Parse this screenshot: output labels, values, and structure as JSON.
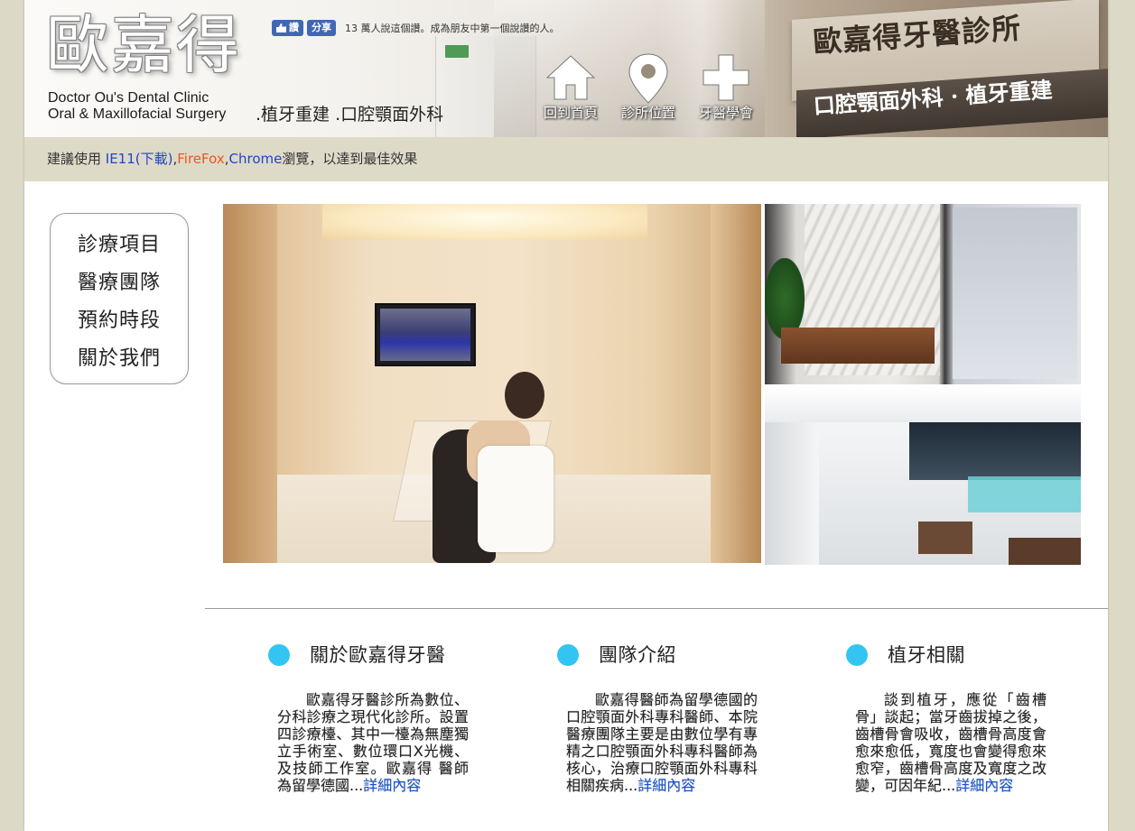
{
  "header": {
    "logo_text": "歐嘉得",
    "english_line1": "Doctor Ou's Dental Clinic",
    "english_line2": "Oral & Maxillofacial Surgery",
    "subtitle": ".植牙重建 .口腔顎面外科",
    "facebook": {
      "like_label": "讚",
      "share_label": "分享",
      "like_text": "13 萬人說這個讚。成為朋友中第一個說讚的人。"
    },
    "nav": [
      {
        "label": "回到首頁",
        "icon": "home-icon"
      },
      {
        "label": "診所位置",
        "icon": "map-pin-icon"
      },
      {
        "label": "牙醫學會",
        "icon": "plus-cross-icon"
      }
    ],
    "sign_title": "歐嘉得牙醫診所",
    "sign_subtitle": "口腔顎面外科 · 植牙重建"
  },
  "notice": {
    "prefix": "建議使用 ",
    "ie": "IE11(下載)",
    "comma1": ",",
    "firefox": "FireFox",
    "comma2": ",",
    "chrome": "Chrome",
    "suffix": "瀏覽，以達到最佳效果"
  },
  "sidebar": {
    "items": [
      "診療項目",
      "醫療團隊",
      "預約時段",
      "關於我們"
    ]
  },
  "sections": [
    {
      "title": "關於歐嘉得牙醫",
      "body": "歐嘉得牙醫診所為數位、分科診療之現代化診所。設置四診療檯、其中一檯為無塵獨立手術室、數位環口X光機、及技師工作室。歐嘉得 醫師為留學德國...",
      "more": "詳細內容"
    },
    {
      "title": "團隊介紹",
      "body": "歐嘉得醫師為留學德國的口腔顎面外科專科醫師、本院醫療團隊主要是由數位學有專精之口腔顎面外科專科醫師為核心，治療口腔顎面外科專科相關疾病...",
      "more": "詳細內容"
    },
    {
      "title": "植牙相關",
      "body": "談到植牙，應從「齒槽骨」談起；當牙齒拔掉之後，齒槽骨會吸收，齒槽骨高度會愈來愈低，寬度也會變得愈來愈窄，齒槽骨高度及寬度之改變，可因年紀...",
      "more": "詳細內容"
    }
  ],
  "colors": {
    "page_bg": "#dcd9c6",
    "notice_bg": "#dedac8",
    "section_dot": "#33c4f2",
    "link_blue": "#1a55cc",
    "firefox_orange": "#ee5522"
  }
}
